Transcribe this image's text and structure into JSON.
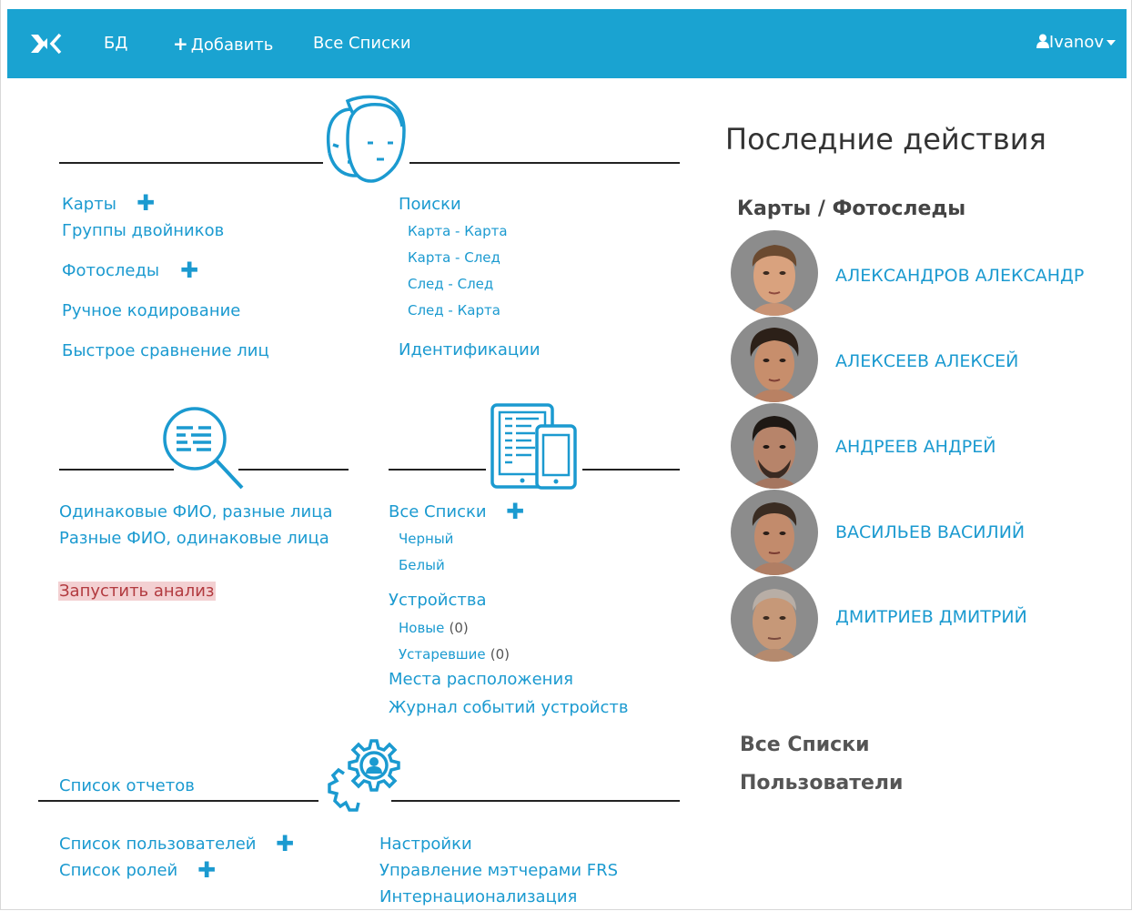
{
  "nav": {
    "db": "БД",
    "add": "Добавить",
    "all_lists": "Все Списки",
    "user": "Ivanov"
  },
  "faces_section": {
    "cards": "Карты",
    "twins": "Группы двойников",
    "photo_traces": "Фотоследы",
    "manual_coding": "Ручное кодирование",
    "quick_compare": "Быстрое сравнение лиц",
    "searches": "Поиски",
    "search_items": [
      "Карта - Карта",
      "Карта - След",
      "След - След",
      "След - Карта"
    ],
    "identifications": "Идентификации"
  },
  "analysis_section": {
    "same_name": "Одинаковые ФИО, разные лица",
    "diff_name": "Разные ФИО, одинаковые лица",
    "run": "Запустить анализ"
  },
  "lists_section": {
    "all_lists": "Все Списки",
    "black": "Черный",
    "white": "Белый",
    "devices": "Устройства",
    "new": "Новые",
    "new_count": "(0)",
    "outdated": "Устаревшие",
    "outdated_count": "(0)",
    "locations": "Места расположения",
    "event_log": "Журнал событий устройств"
  },
  "admin_section": {
    "reports": "Список отчетов",
    "users": "Список пользователей",
    "roles": "Список ролей",
    "settings": "Настройки",
    "matchers": "Управление мэтчерами FRS",
    "i18n": "Интернационализация"
  },
  "recent": {
    "title": "Последние действия",
    "subtitle": "Карты / Фотоследы",
    "people": [
      "АЛЕКСАНДРОВ АЛЕКСАНДР",
      "АЛЕКСЕЕВ АЛЕКСЕЙ",
      "АНДРЕЕВ АНДРЕЙ",
      "ВАСИЛЬЕВ  ВАСИЛИЙ",
      "ДМИТРИЕВ  ДМИТРИЙ"
    ],
    "all_lists": "Все Списки",
    "users": "Пользователи"
  },
  "icons": {
    "logo": "app-logo-icon",
    "faces": "faces-icon",
    "analysis": "document-search-icon",
    "devices": "tablet-phone-icon",
    "settings": "gear-user-icon",
    "user": "user-icon",
    "plus": "plus-icon"
  },
  "colors": {
    "navbar": "#1aa3d1",
    "link": "#1b9ad0",
    "run_bg": "#f3d0d2",
    "run_text": "#b23a3f"
  }
}
